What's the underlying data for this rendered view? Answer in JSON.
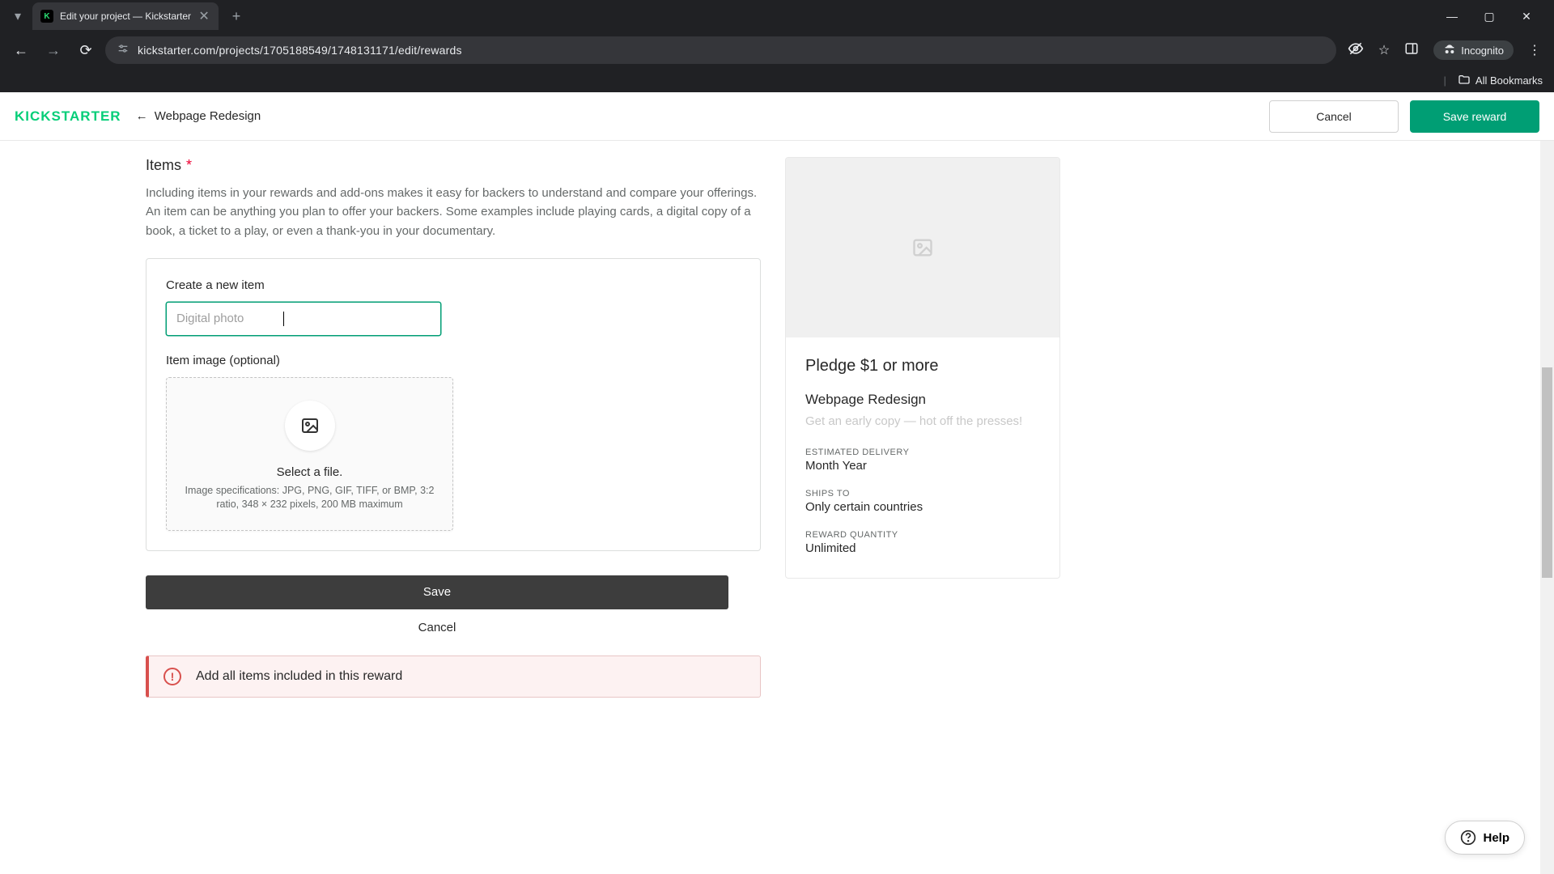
{
  "browser": {
    "tab_title": "Edit your project — Kickstarter",
    "url": "kickstarter.com/projects/1705188549/1748131171/edit/rewards",
    "incognito_label": "Incognito",
    "all_bookmarks": "All Bookmarks"
  },
  "header": {
    "logo": "KICKSTARTER",
    "back_arrow": "←",
    "back_label": "Webpage Redesign",
    "cancel": "Cancel",
    "save": "Save reward"
  },
  "items_section": {
    "title": "Items",
    "required_mark": "*",
    "description": "Including items in your rewards and add-ons makes it easy for backers to understand and compare your offerings. An item can be anything you plan to offer your backers. Some examples include playing cards, a digital copy of a book, a ticket to a play, or even a thank-you in your documentary."
  },
  "new_item": {
    "label": "Create a new item",
    "placeholder": "Digital photo",
    "value": "",
    "image_label": "Item image (optional)",
    "drop_title": "Select a file.",
    "drop_spec": "Image specifications: JPG, PNG, GIF, TIFF, or BMP, 3:2 ratio, 348 × 232 pixels, 200 MB maximum",
    "save": "Save",
    "cancel": "Cancel"
  },
  "alert": {
    "text": "Add all items included in this reward"
  },
  "preview": {
    "pledge_title": "Pledge $1 or more",
    "pledge_name": "Webpage Redesign",
    "pledge_desc": "Get an early copy — hot off the presses!",
    "delivery_label": "ESTIMATED DELIVERY",
    "delivery_value": "Month Year",
    "ships_label": "SHIPS TO",
    "ships_value": "Only certain countries",
    "qty_label": "REWARD QUANTITY",
    "qty_value": "Unlimited"
  },
  "help": {
    "label": "Help"
  }
}
